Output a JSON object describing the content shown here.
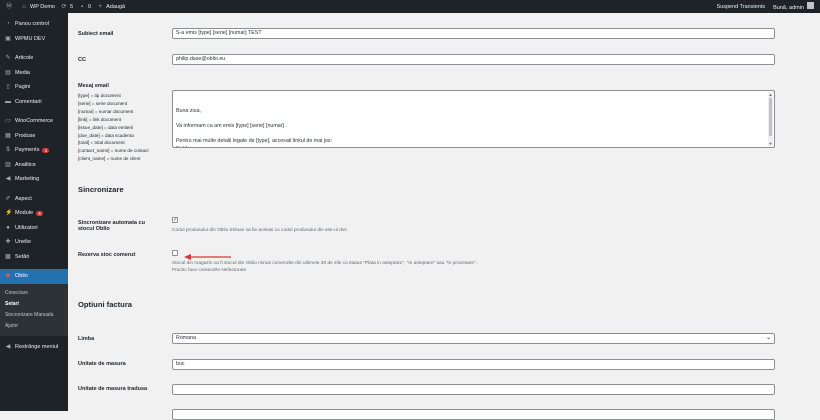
{
  "adminbar": {
    "site_name": "WP Demo",
    "updates_count": "5",
    "comments_count": "0",
    "new_label": "Adaugă",
    "suspend_label": "Suspend Transients",
    "greeting": "Bună, admin"
  },
  "sidebar": {
    "items": [
      {
        "icon": "dashboard-icon",
        "label": "Panou control"
      },
      {
        "icon": "wpmu-icon",
        "label": "WPMU DEV"
      },
      {
        "icon": "pin-icon",
        "label": "Articole"
      },
      {
        "icon": "media-icon",
        "label": "Media"
      },
      {
        "icon": "pages-icon",
        "label": "Pagini"
      },
      {
        "icon": "comments-icon",
        "label": "Comentarii"
      },
      {
        "icon": "woocommerce-icon",
        "label": "WooCommerce"
      },
      {
        "icon": "products-icon",
        "label": "Produse"
      },
      {
        "icon": "payments-icon",
        "label": "Payments",
        "badge": "1"
      },
      {
        "icon": "analytics-icon",
        "label": "Analitice"
      },
      {
        "icon": "marketing-icon",
        "label": "Marketing"
      },
      {
        "icon": "appearance-icon",
        "label": "Aspect"
      },
      {
        "icon": "plugins-icon",
        "label": "Module",
        "badge": "4"
      },
      {
        "icon": "users-icon",
        "label": "Utilizatori"
      },
      {
        "icon": "tools-icon",
        "label": "Unelte"
      },
      {
        "icon": "settings-icon",
        "label": "Setări"
      },
      {
        "icon": "oblio-icon",
        "label": "Oblio"
      }
    ],
    "submenu": [
      "Conectare",
      "Setari",
      "Sincronizare Manuala",
      "Ajutor"
    ],
    "collapse_label": "Restrânge meniul"
  },
  "form": {
    "subject_label": "Subiect email",
    "subject_value": "S-a emis [type] [serie] [numar] TEST",
    "cc_label": "CC",
    "cc_value": "philip.dase@oblio.eu",
    "message_label": "Mesaj email",
    "placeholders": [
      "[type] = tip document",
      "[serie] = serie document",
      "[numar] = numar document",
      "[link] = link document",
      "[issue_date] = data emiterii",
      "[due_date] = data scadenta",
      "[total] = total document",
      "[contact_name] = nume de contact",
      "[client_name] = nume de client"
    ],
    "message_value": "Buna ziua,\n\nVa informam ca am emis [type] [serie] [numar] .\n\nPentru mai multe detalii legate de [type], accesati linkul de mai jos:\n[link]",
    "sync_heading": "Sincronizare",
    "auto_sync_label_1": "Sincronizare automata cu",
    "auto_sync_label_2": "stocul Oblio",
    "auto_sync_desc": "Codul produsului din Oblio trebuie sa fie acelasi cu codul produsului din site-ul dvs.",
    "reserve_label": "Rezerva stoc comenzi",
    "reserve_desc_1": "Stocul din magazin va fi stocul din Oblio minus comenzile din ultimele 30 de zile cu status \"Plata in asteptare\", \"In asteptare\" sau \"In procesare\".",
    "reserve_desc_2": "Practic face comenzile Nefacturate",
    "invoice_heading": "Optiuni factura",
    "language_label": "Limba",
    "language_value": "Romana",
    "unit_label": "Unitate de masura",
    "unit_value": "buc",
    "unit_translated_label": "Unitate de masura tradusa",
    "unit_translated_value": ""
  },
  "colors": {
    "accent": "#2271b1",
    "arrow": "#d63638",
    "admin_dark": "#1d2327"
  }
}
